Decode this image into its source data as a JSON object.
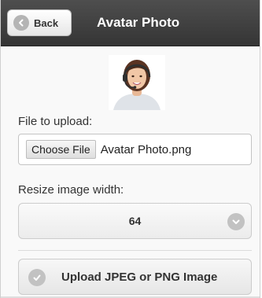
{
  "header": {
    "title": "Avatar Photo",
    "back_label": "Back"
  },
  "avatar": {
    "icon": "user-avatar-photo"
  },
  "file_upload": {
    "label": "File to upload:",
    "button_label": "Choose File",
    "file_name": "Avatar Photo.png"
  },
  "resize": {
    "label": "Resize image width:",
    "selected_value": "64"
  },
  "upload": {
    "button_label": "Upload JPEG or PNG Image"
  },
  "colors": {
    "header_bg": "#3c3c3c",
    "page_bg": "#f9f9f9",
    "icon_circle": "#c2c2c2"
  },
  "icons": {
    "back": "chevron-left-icon",
    "select": "chevron-down-icon",
    "upload": "check-icon"
  }
}
